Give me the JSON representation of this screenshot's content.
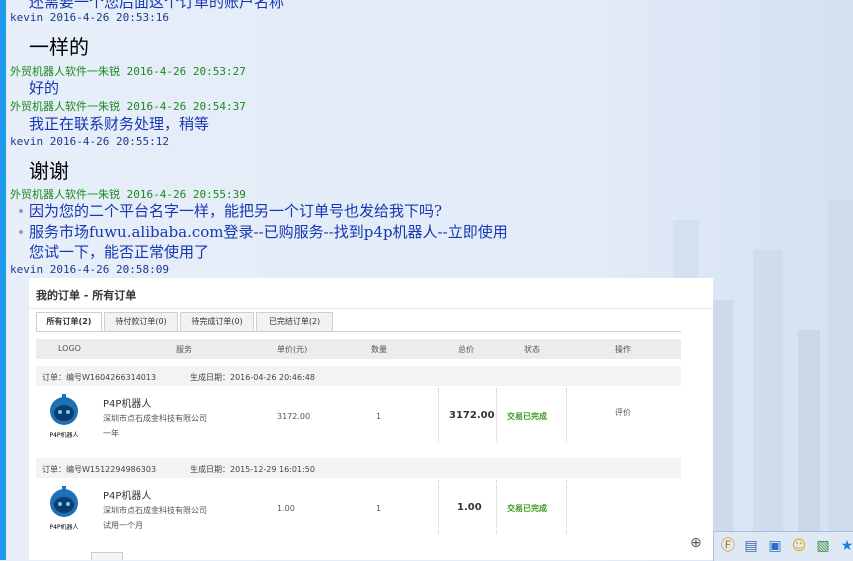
{
  "chat": {
    "partial_top": "还需要一个您后面这个订单的账户名称",
    "messages": [
      {
        "sender": "kevin",
        "time": "2016-4-26 20:53:16",
        "text": "一样的"
      },
      {
        "sender": "外贸机器人软件一朱锐",
        "time": "2016-4-26 20:53:27",
        "text": "好的"
      },
      {
        "sender": "外贸机器人软件一朱锐",
        "time": "2016-4-26 20:54:37",
        "text": "我正在联系财务处理，稍等"
      },
      {
        "sender": "kevin",
        "time": "2016-4-26 20:55:12",
        "text": "谢谢"
      },
      {
        "sender": "外贸机器人软件一朱锐",
        "time": "2016-4-26 20:55:39",
        "lines": [
          "因为您的二个平台名字一样，能把另一个订单号也发给我下吗?",
          "服务市场fuwu.alibaba.com登录--已购服务--找到p4p机器人--立即使用",
          "您试一下，能否正常使用了"
        ]
      },
      {
        "sender": "kevin",
        "time": "2016-4-26 20:58:09"
      }
    ]
  },
  "orders": {
    "title": "我的订单 - 所有订单",
    "tabs": [
      "所有订单(2)",
      "待付款订单(0)",
      "待完成订单(0)",
      "已完结订单(2)"
    ],
    "columns": [
      "LOGO",
      "服务",
      "单价(元)",
      "数量",
      "总价",
      "状态",
      "操作"
    ],
    "order_list": [
      {
        "order_no": "订单：编号W1604266314013",
        "created": "生成日期：2016-04-26 20:46:48",
        "product": "P4P机器人",
        "vendor": "深圳市点石成金科技有限公司",
        "term": "一年",
        "price": "3172.00",
        "qty": "1",
        "total": "3172.00",
        "status": "交易已完成",
        "action": "评价",
        "logo_caption": "P4P机器人"
      },
      {
        "order_no": "订单：编号W1512294986303",
        "created": "生成日期：2015-12-29 16:01:50",
        "product": "P4P机器人",
        "vendor": "深圳市点石成金科技有限公司",
        "term": "试用一个月",
        "price": "1.00",
        "qty": "1",
        "total": "1.00",
        "status": "交易已完成",
        "action": "",
        "logo_caption": "P4P机器人"
      }
    ]
  },
  "colors": {
    "kevin": "#1a3c8c",
    "robot": "#1b8a1b",
    "message": "#1637b3",
    "status": "#3a9a1d"
  },
  "toolbar_icons": [
    "font-icon",
    "save-icon",
    "screen-icon",
    "emoji-icon",
    "image-icon",
    "star-icon"
  ]
}
